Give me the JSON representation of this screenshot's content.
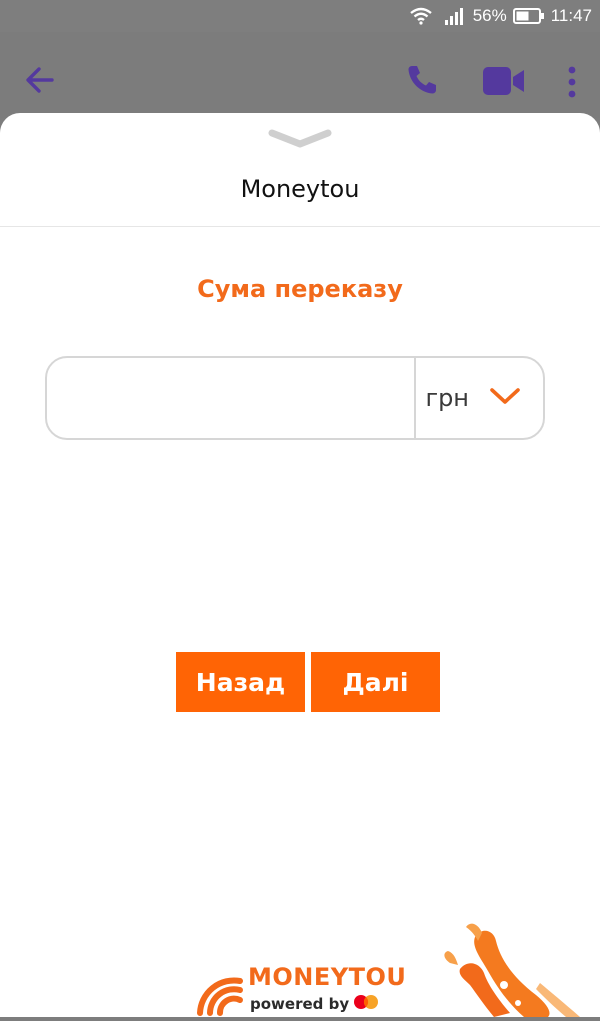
{
  "status_bar": {
    "battery_percent": "56%",
    "time": "11:47",
    "icons": [
      "wifi-icon",
      "signal-icon",
      "battery-icon"
    ]
  },
  "app_bar": {
    "icons": [
      "back-arrow-icon",
      "phone-icon",
      "video-camera-icon",
      "more-vertical-icon"
    ],
    "icon_color": "#5b3bb0"
  },
  "sheet": {
    "title": "Moneytou",
    "handle_icon": "chevron-down-icon"
  },
  "form": {
    "heading": "Сума переказу",
    "amount_value": "",
    "amount_placeholder": "",
    "currency": "грн",
    "currency_icon": "chevron-down-icon"
  },
  "buttons": {
    "back_label": "Назад",
    "next_label": "Далі"
  },
  "footer": {
    "brand": "MONEYTOU",
    "powered_by": "powered by",
    "partner_icon": "mastercard-icon"
  },
  "colors": {
    "accent": "#ff6405",
    "heading": "#f26a1b",
    "overlay": "#7d7d7d"
  }
}
